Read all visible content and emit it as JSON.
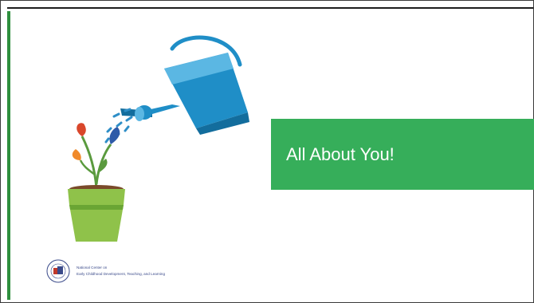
{
  "slide": {
    "title": "All About You!",
    "footer": {
      "org_line_1": "National Center on",
      "org_line_2": "Early Childhood Development, Teaching, and Learning"
    }
  },
  "colors": {
    "accent_green": "#36ae5a",
    "left_bar": "#2f8f3e",
    "watering_can": "#1f8ec7",
    "pot": "#8fc24a",
    "leaf_red": "#d9472b",
    "leaf_orange": "#f08a2b",
    "leaf_blue": "#2e5aa8",
    "leaf_green": "#5a9a3e"
  },
  "icons": [
    "watering-can-icon",
    "plant-pot-icon",
    "ohs-seal-icon"
  ]
}
